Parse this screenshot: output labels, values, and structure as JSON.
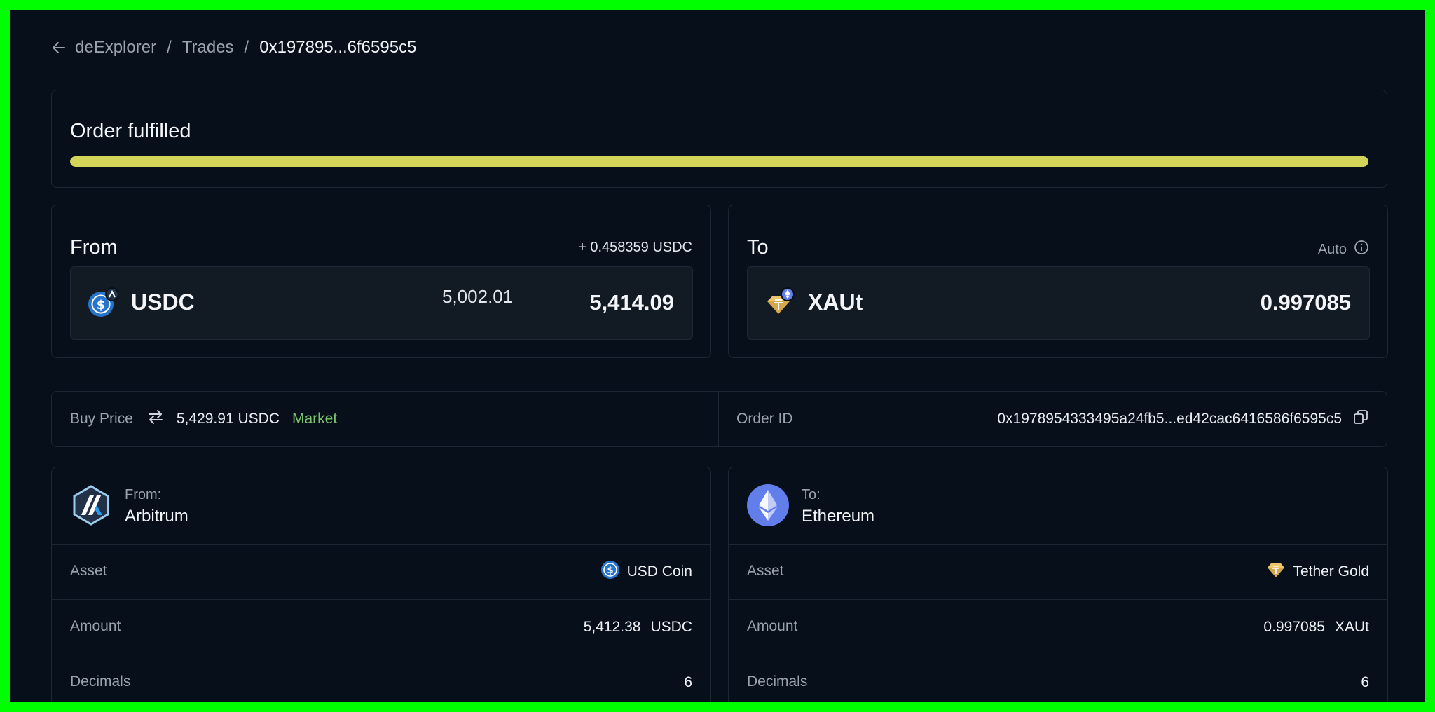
{
  "breadcrumb": {
    "root": "deExplorer",
    "section": "Trades",
    "current": "0x197895...6f6595c5",
    "separator": "/"
  },
  "status": {
    "title": "Order fulfilled",
    "progress": 1.0,
    "color": "#d3d559"
  },
  "from": {
    "label": "From",
    "extra": "+ 0.458359 USDC",
    "token": "USDC",
    "secondary_amount": "5,002.01",
    "amount": "5,414.09",
    "icon": "usdc-icon"
  },
  "to": {
    "label": "To",
    "extra": "Auto",
    "token": "XAUt",
    "amount": "0.997085",
    "icon": "xaut-icon"
  },
  "price": {
    "label": "Buy Price",
    "value": "5,429.91 USDC",
    "type": "Market",
    "order_id_label": "Order ID",
    "order_id": "0x1978954333495a24fb5...ed42cac6416586f6595c5"
  },
  "from_chain": {
    "direction": "From:",
    "name": "Arbitrum",
    "rows": [
      {
        "key": "Asset",
        "value": "USD Coin"
      },
      {
        "key": "Amount",
        "value": "5,412.38",
        "unit": "USDC"
      },
      {
        "key": "Decimals",
        "value": "6"
      }
    ]
  },
  "to_chain": {
    "direction": "To:",
    "name": "Ethereum",
    "rows": [
      {
        "key": "Asset",
        "value": "Tether Gold"
      },
      {
        "key": "Amount",
        "value": "0.997085",
        "unit": "XAUt"
      },
      {
        "key": "Decimals",
        "value": "6"
      }
    ]
  }
}
